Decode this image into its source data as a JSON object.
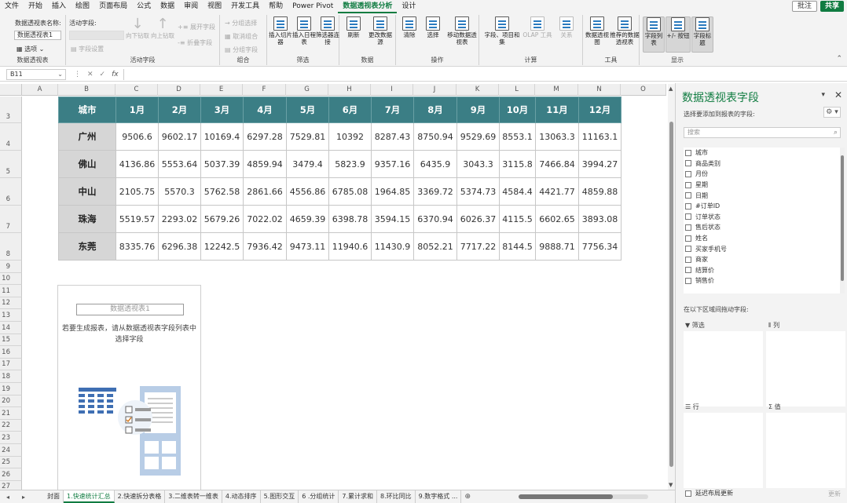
{
  "menu": {
    "tabs": [
      "文件",
      "开始",
      "插入",
      "绘图",
      "页面布局",
      "公式",
      "数据",
      "审阅",
      "视图",
      "开发工具",
      "帮助",
      "Power Pivot",
      "数据透视表分析",
      "设计"
    ],
    "active_index": 12,
    "comment_label": "批注",
    "share_label": "共享"
  },
  "ribbon": {
    "pt_name_label": "数据透视表名称:",
    "pt_name_value": "数据透视表1",
    "options_label": "选项",
    "group_pt": "数据透视表",
    "active_field_label": "活动字段:",
    "field_settings": "字段设置",
    "drill_down": "向下钻取",
    "drill_up": "向上钻取",
    "expand_field": "展开字段",
    "collapse_field": "折叠字段",
    "group_active_field": "活动字段",
    "group_selection": "分组选择",
    "ungroup": "取消组合",
    "group_field": "分组字段",
    "group_group": "组合",
    "insert_slicer": "插入切片器",
    "insert_timeline": "插入日程表",
    "filter_connections": "筛选器连接",
    "group_filter": "筛选",
    "refresh": "刷新",
    "change_source": "更改数据源",
    "group_data": "数据",
    "clear": "清除",
    "select": "选择",
    "move_pt": "移动数据透视表",
    "group_actions": "操作",
    "fields_items": "字段、项目和集",
    "olap_tools": "OLAP 工具",
    "relationships": "关系",
    "group_calc": "计算",
    "pivot_chart": "数据透视图",
    "recommended_pt": "推荐的数据透视表",
    "group_tools": "工具",
    "field_list": "字段列表",
    "plus_minus": "+/- 按钮",
    "field_headers": "字段标题",
    "group_show": "显示"
  },
  "formula_bar": {
    "name_box": "B11",
    "fx": "fx"
  },
  "grid": {
    "columns": [
      "A",
      "B",
      "C",
      "D",
      "E",
      "F",
      "G",
      "H",
      "I",
      "J",
      "K",
      "L",
      "M",
      "N",
      "O"
    ],
    "rows": [
      "3",
      "4",
      "5",
      "6",
      "7",
      "8",
      "9",
      "10",
      "11",
      "12",
      "13",
      "14",
      "15",
      "16",
      "17",
      "18",
      "19",
      "20",
      "21",
      "22",
      "23",
      "24",
      "25",
      "26",
      "27"
    ]
  },
  "table": {
    "headers": [
      "城市",
      "1月",
      "2月",
      "3月",
      "4月",
      "5月",
      "6月",
      "7月",
      "8月",
      "9月",
      "10月",
      "11月",
      "12月"
    ],
    "rows": [
      {
        "city": "广州",
        "values": [
          "9506.6",
          "9602.17",
          "10169.4",
          "6297.28",
          "7529.81",
          "10392",
          "8287.43",
          "8750.94",
          "9529.69",
          "8553.1",
          "13063.3",
          "11163.1"
        ]
      },
      {
        "city": "佛山",
        "values": [
          "4136.86",
          "5553.64",
          "5037.39",
          "4859.94",
          "3479.4",
          "5823.9",
          "9357.16",
          "6435.9",
          "3043.3",
          "3115.8",
          "7466.84",
          "3994.27"
        ]
      },
      {
        "city": "中山",
        "values": [
          "2105.75",
          "5570.3",
          "5762.58",
          "2861.66",
          "4556.86",
          "6785.08",
          "1964.85",
          "3369.72",
          "5374.73",
          "4584.4",
          "4421.77",
          "4859.88"
        ]
      },
      {
        "city": "珠海",
        "values": [
          "5519.57",
          "2293.02",
          "5679.26",
          "7022.02",
          "4659.39",
          "6398.78",
          "3594.15",
          "6370.94",
          "6026.37",
          "4115.5",
          "6602.65",
          "3893.08"
        ]
      },
      {
        "city": "东莞",
        "values": [
          "8335.76",
          "6296.38",
          "12242.5",
          "7936.42",
          "9473.11",
          "11940.6",
          "11430.9",
          "8052.21",
          "7717.22",
          "8144.5",
          "9888.71",
          "7756.34"
        ]
      }
    ],
    "header_color": "#3b7e85"
  },
  "placeholder": {
    "title": "数据透视表1",
    "text": "若要生成报表，请从数据透视表字段列表中选择字段"
  },
  "pane": {
    "title": "数据透视表字段",
    "subtitle": "选择要添加到报表的字段:",
    "search_placeholder": "搜索",
    "fields": [
      "城市",
      "商品类别",
      "月份",
      "星期",
      "日期",
      "#订单ID",
      "订单状态",
      "售后状态",
      "姓名",
      "买家手机号",
      "商家",
      "结算价",
      "销售价"
    ],
    "drag_label": "在以下区域间拖动字段:",
    "filter_label": "筛选",
    "columns_label": "列",
    "rows_label": "行",
    "values_label": "值",
    "defer_label": "延迟布局更新",
    "update_label": "更新"
  },
  "sheets": {
    "tabs": [
      "封面",
      "1.快速统计汇总",
      "2.快速拆分表格",
      "3.二维表转一维表",
      "4.动态排序",
      "5.图形交互",
      "6 .分组统计",
      "7.累计求和",
      "8.环比同比",
      "9.数字格式 ..."
    ],
    "active_index": 1
  },
  "colors": {
    "accent": "#107c41",
    "header_teal": "#3b7e85",
    "city_cell": "#d6d6d6"
  }
}
